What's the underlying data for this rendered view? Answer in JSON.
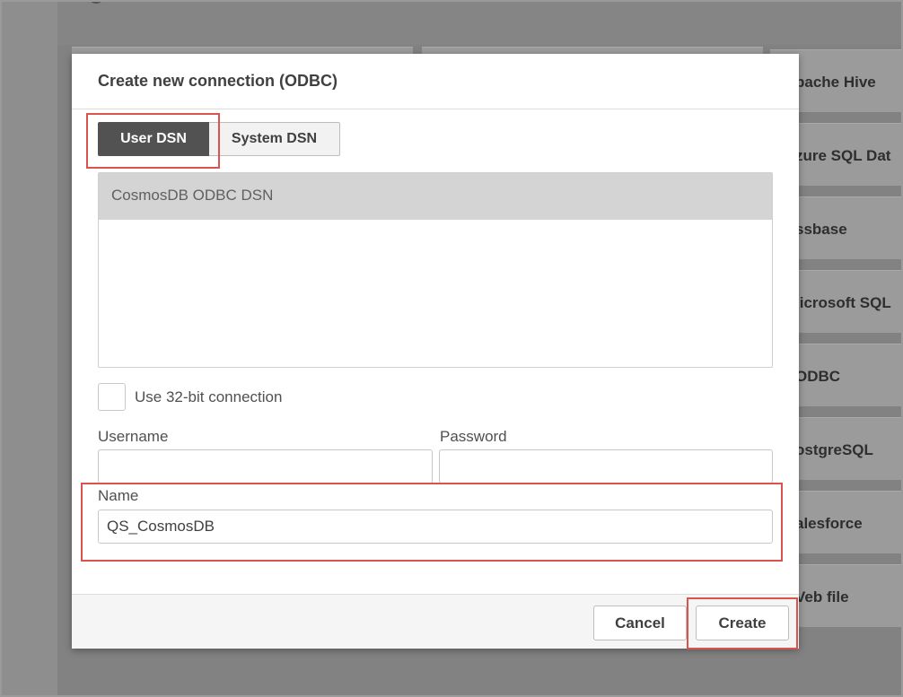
{
  "background": {
    "connector_cards": [
      "pache Hive",
      "zure SQL Dat",
      "ssbase",
      "licrosoft SQL",
      "ODBC",
      "ostgreSQL",
      "alesforce",
      "Veb file"
    ]
  },
  "dialog": {
    "title": "Create new connection (ODBC)",
    "tabs": [
      {
        "label": "User DSN",
        "active": true
      },
      {
        "label": "System DSN",
        "active": false
      }
    ],
    "dsn_list": [
      "CosmosDB ODBC DSN"
    ],
    "checkbox": {
      "label": "Use 32-bit connection",
      "checked": false
    },
    "username": {
      "label": "Username",
      "value": ""
    },
    "password": {
      "label": "Password",
      "value": ""
    },
    "name": {
      "label": "Name",
      "value": "QS_CosmosDB"
    },
    "buttons": {
      "cancel": "Cancel",
      "create": "Create"
    }
  },
  "colors": {
    "highlight": "#d9534f",
    "active_tab": "#525252"
  }
}
